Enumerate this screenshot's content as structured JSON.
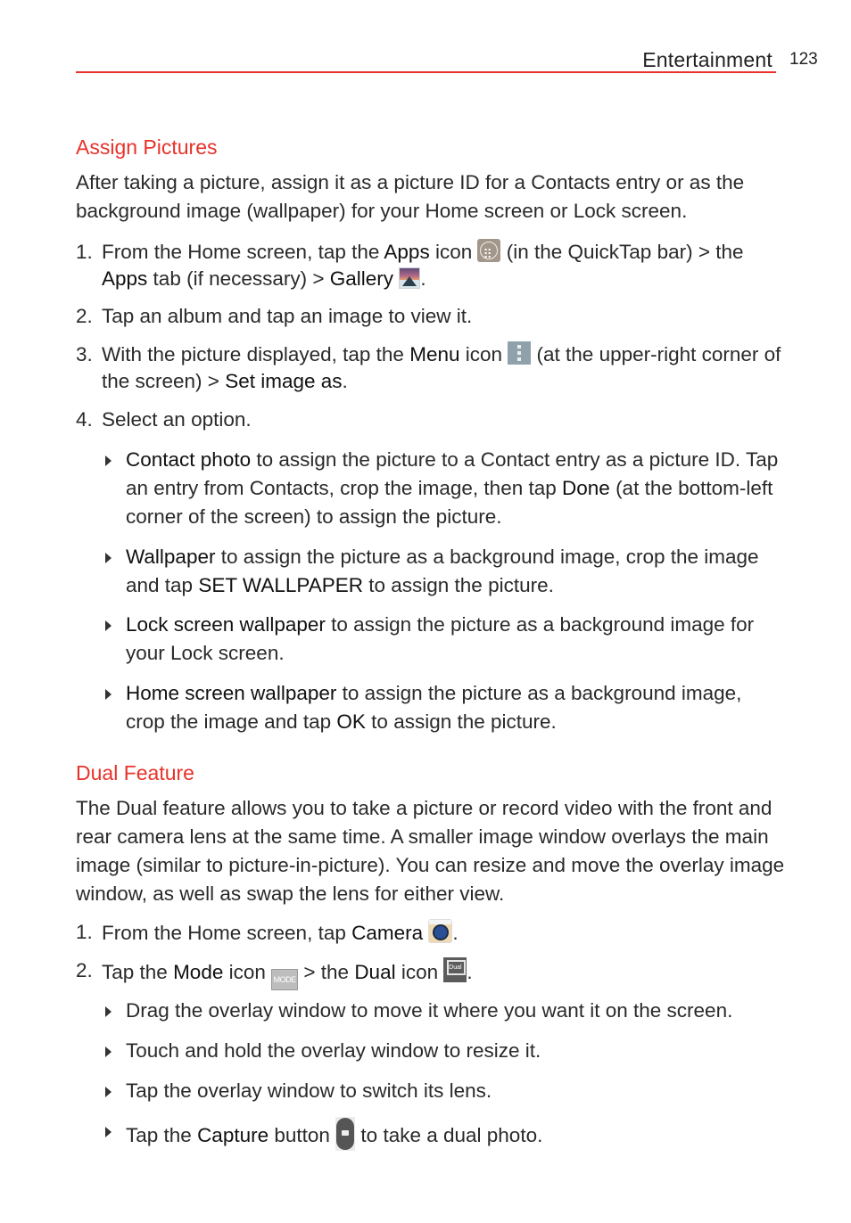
{
  "header": {
    "title": "Entertainment",
    "page_number": "123",
    "accent_color": "#e8322a"
  },
  "assign_pictures": {
    "title": "Assign Pictures",
    "intro": "After taking a picture, assign it as a picture ID for a Contacts entry or as the background image (wallpaper) for your Home screen or Lock screen.",
    "steps": [
      {
        "num": "1.",
        "t1": "From the Home screen, tap the ",
        "b1": "Apps",
        "t2": " icon ",
        "icon1": "apps-icon",
        "t3": " (in the QuickTap bar) > the ",
        "b2": "Apps",
        "t4": " tab (if necessary) > ",
        "b3": "Gallery",
        "icon2": "gallery-icon",
        "t5": "."
      },
      {
        "num": "2.",
        "t1": "Tap an album and tap an image to view it."
      },
      {
        "num": "3.",
        "t1": "With the picture displayed, tap the ",
        "b1": "Menu",
        "t2": " icon ",
        "icon1": "menu-icon",
        "t3": " (at the upper-right corner of the screen) > ",
        "b2": "Set image as",
        "t4": "."
      },
      {
        "num": "4.",
        "t1": "Select an option."
      }
    ],
    "options": [
      {
        "b1": "Contact photo",
        "t1": " to assign the picture to a Contact entry as a picture ID. Tap an entry from Contacts, crop the image, then tap ",
        "b2": "Done",
        "t2": " (at the bottom-left corner of the screen) to assign the picture."
      },
      {
        "b1": "Wallpaper",
        "t1": " to assign the picture as a background image, crop the image and tap ",
        "b2": "SET WALLPAPER",
        "t2": " to assign the picture."
      },
      {
        "b1": "Lock screen wallpaper",
        "t1": " to assign the picture as a background image for your Lock screen."
      },
      {
        "b1": "Home screen wallpaper",
        "t1": " to assign the picture as a background image, crop the image and tap ",
        "b2": "OK",
        "t2": " to assign the picture."
      }
    ]
  },
  "dual_feature": {
    "title": "Dual Feature",
    "intro": "The Dual feature allows you to take a picture or record video with the front and rear camera lens at the same time. A smaller image window overlays the main image (similar to picture-in-picture). You can resize and move the overlay image window, as well as swap the lens for either view.",
    "steps": [
      {
        "num": "1.",
        "t1": "From the Home screen, tap ",
        "b1": "Camera",
        "icon1": "camera-icon",
        "t2": "."
      },
      {
        "num": "2.",
        "t1": "Tap the ",
        "b1": "Mode",
        "t2": " icon ",
        "icon1": "mode-icon",
        "icon1_text": "MODE",
        "t3": " > the ",
        "b2": "Dual",
        "t4": " icon ",
        "icon2": "dual-icon",
        "icon2_text": "Dual",
        "t5": "."
      }
    ],
    "options": [
      {
        "t1": "Drag the overlay window to move it where you want it on the screen."
      },
      {
        "t1": "Touch and hold the overlay window to resize it."
      },
      {
        "t1": "Tap the overlay window to switch its lens."
      },
      {
        "t1": "Tap the ",
        "b1": "Capture",
        "t2": " button ",
        "icon1": "capture-icon",
        "t3": " to take a dual photo."
      }
    ]
  }
}
